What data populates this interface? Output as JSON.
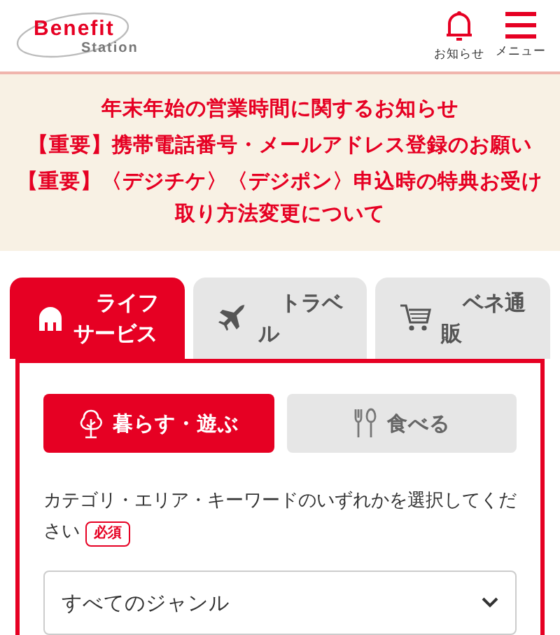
{
  "header": {
    "logo": {
      "title": "Benefit",
      "subtitle": "Station"
    },
    "actions": [
      {
        "kind": "bell",
        "label": "お知らせ"
      },
      {
        "kind": "menu",
        "label": "メニュー"
      }
    ]
  },
  "notices": [
    "年末年始の営業時間に関するお知らせ",
    "【重要】携帯電話番号・メールアドレス登録のお願い",
    "【重要】〈デジチケ〉〈デジポン〉申込時の特典お受け取り方法変更について"
  ],
  "tabs": [
    {
      "kind": "life",
      "label": "ライフサービス",
      "selected": true
    },
    {
      "kind": "travel",
      "label": "トラベル",
      "selected": false
    },
    {
      "kind": "cart",
      "label": "ベネ通販",
      "selected": false
    }
  ],
  "subtabs": [
    {
      "kind": "tree",
      "label": "暮らす・遊ぶ",
      "selected": true
    },
    {
      "kind": "cutlery",
      "label": "食べる",
      "selected": false
    }
  ],
  "instruction": "カテゴリ・エリア・キーワードのいずれかを選択してください",
  "required_badge": "必須",
  "genre_select": {
    "value": "すべてのジャンル"
  }
}
